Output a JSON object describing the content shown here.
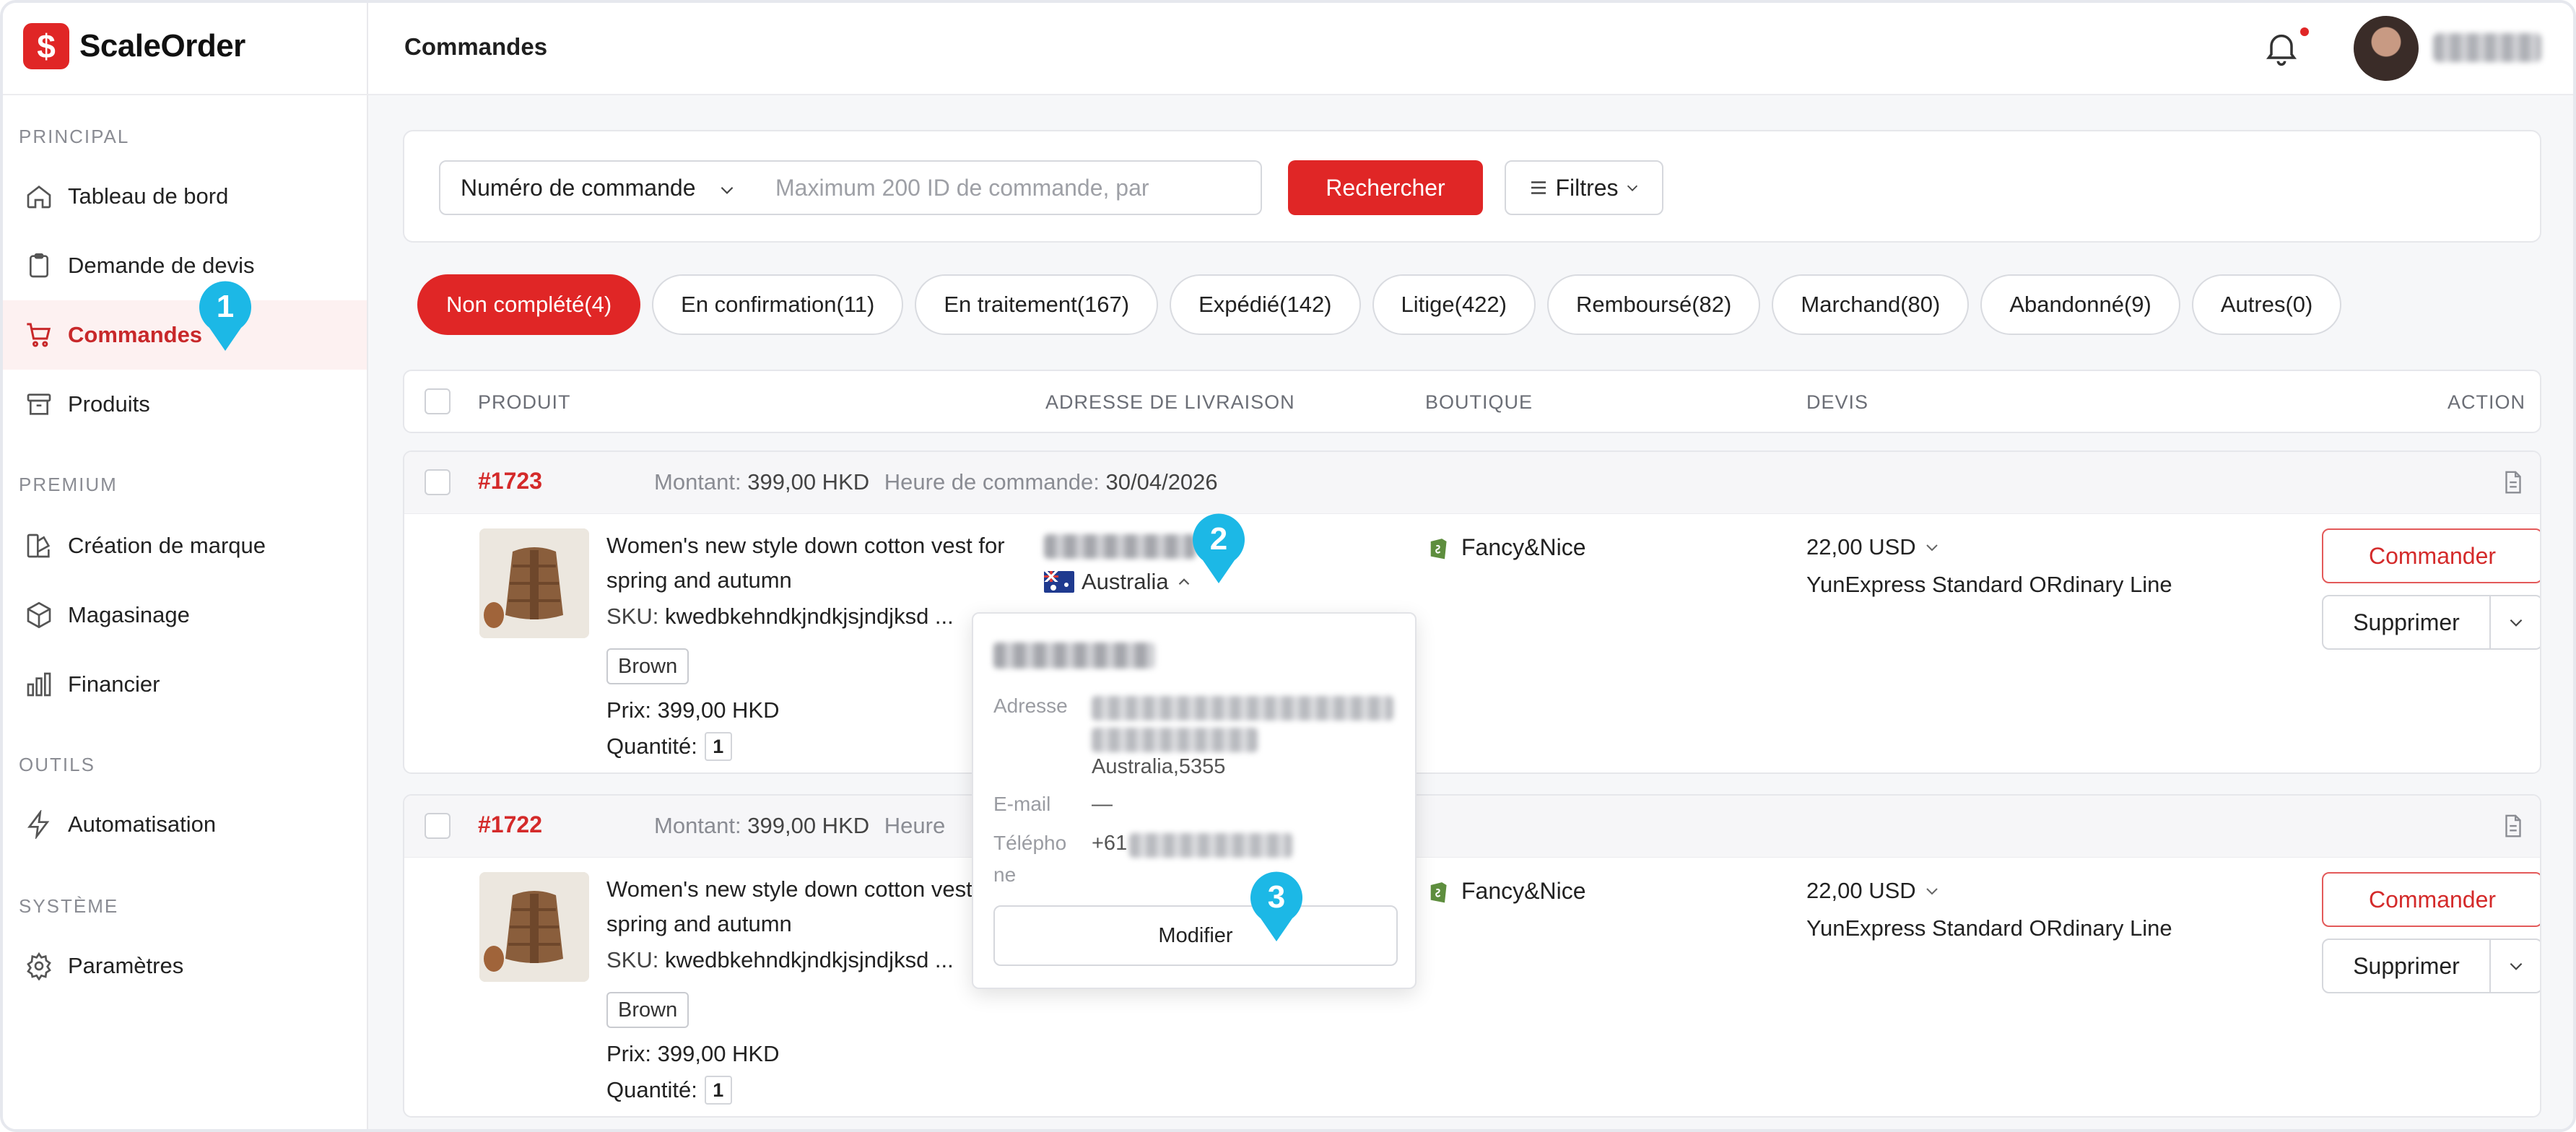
{
  "app": {
    "name": "ScaleOrder",
    "logo_glyph": "$",
    "accent": "#e02626"
  },
  "sidebar": {
    "sections": [
      {
        "title": "PRINCIPAL",
        "items": [
          {
            "label": "Tableau de bord",
            "icon": "home-icon"
          },
          {
            "label": "Demande de devis",
            "icon": "clipboard-icon"
          },
          {
            "label": "Commandes",
            "icon": "cart-icon",
            "active": true
          },
          {
            "label": "Produits",
            "icon": "archive-icon"
          }
        ]
      },
      {
        "title": "PREMIUM",
        "items": [
          {
            "label": "Création de marque",
            "icon": "palette-icon"
          },
          {
            "label": "Magasinage",
            "icon": "box-icon"
          },
          {
            "label": "Financier",
            "icon": "bar-chart-icon"
          }
        ]
      },
      {
        "title": "OUTILS",
        "items": [
          {
            "label": "Automatisation",
            "icon": "lightning-icon"
          }
        ]
      },
      {
        "title": "SYSTÈME",
        "items": [
          {
            "label": "Paramètres",
            "icon": "gear-icon"
          }
        ]
      }
    ]
  },
  "header": {
    "title": "Commandes"
  },
  "search": {
    "field_select": "Numéro de commande",
    "placeholder": "Maximum 200 ID de commande, par",
    "search_label": "Rechercher",
    "filter_label": "Filtres"
  },
  "tabs": [
    {
      "label": "Non complété(4)",
      "active": true
    },
    {
      "label": "En confirmation(11)"
    },
    {
      "label": "En traitement(167)"
    },
    {
      "label": "Expédié(142)"
    },
    {
      "label": "Litige(422)"
    },
    {
      "label": "Remboursé(82)"
    },
    {
      "label": "Marchand(80)"
    },
    {
      "label": "Abandonné(9)"
    },
    {
      "label": "Autres(0)"
    }
  ],
  "table": {
    "columns": {
      "product": "PRODUIT",
      "address": "ADRESSE DE LIVRAISON",
      "shop": "BOUTIQUE",
      "quote": "DEVIS",
      "action": "ACTION"
    }
  },
  "orders": [
    {
      "id": "#1723",
      "amount_label": "Montant:",
      "amount": "399,00 HKD",
      "time_label": "Heure de commande:",
      "time": "30/04/2026",
      "product_title": "Women's new style down cotton vest for spring and autumn",
      "sku_label": "SKU:",
      "sku": "kwedbkehndkjndkjsjndjksd ...",
      "variant": "Brown",
      "price": "Prix: 399,00 HKD",
      "qty_label": "Quantité:",
      "qty": "1",
      "country": "Australia",
      "shop": "Fancy&Nice",
      "quote_amount": "22,00 USD",
      "shipping_line": "YunExpress Standard ORdinary Line",
      "order_btn": "Commander",
      "delete_btn": "Supprimer"
    },
    {
      "id": "#1722",
      "amount_label": "Montant:",
      "amount": "399,00 HKD",
      "time_label": "Heure",
      "time": "",
      "product_title": "Women's new style down cotton vest for spring and autumn",
      "sku_label": "SKU:",
      "sku": "kwedbkehndkjndkjsjndjksd ...",
      "variant": "Brown",
      "price": "Prix: 399,00 HKD",
      "qty_label": "Quantité:",
      "qty": "1",
      "country": "",
      "shop": "Fancy&Nice",
      "quote_amount": "22,00 USD",
      "shipping_line": "YunExpress Standard ORdinary Line",
      "order_btn": "Commander",
      "delete_btn": "Supprimer"
    }
  ],
  "popover": {
    "address_label": "Adresse",
    "address_tail": "Australia,5355",
    "email_label": "E-mail",
    "email_value": "—",
    "phone_label": "Télépho ne",
    "phone_prefix": "+61",
    "edit_label": "Modifier"
  },
  "markers": [
    "1",
    "2",
    "3"
  ],
  "marker_color": "#1cb8e6"
}
